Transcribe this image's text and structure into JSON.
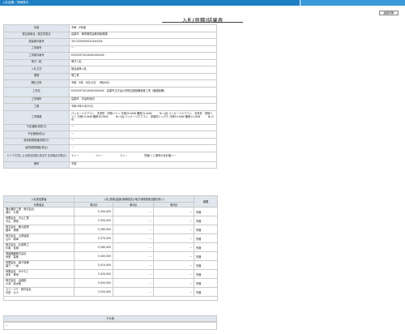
{
  "header": {
    "title": "入札結果／詳細表示"
  },
  "toolbar": {
    "print_label": "画面印刷"
  },
  "page_title": "入札(見積)結果表",
  "info_rows": [
    {
      "label": "年度",
      "value": "令和　6年度"
    },
    {
      "label": "発注部局名／発注所属名",
      "value": "高梁市　教育委員会教育総務課"
    },
    {
      "label": "調達案件番号",
      "value": "3311335500020240004"
    },
    {
      "label": "工事番号",
      "value": "－"
    },
    {
      "label": "工事案件番号",
      "value": "K3320972024050000004"
    },
    {
      "label": "電子／紙",
      "value": "電子入札"
    },
    {
      "label": "入札方式",
      "value": "指名競争入札"
    },
    {
      "label": "業種",
      "value": "電工事"
    },
    {
      "label": "開札日時",
      "value": "令和　6年　6月12日　 9時00分"
    },
    {
      "label": "工事名",
      "value": "K3320972024050000004　高梁市立宇治小学校空調設備設置工事（機械設備）"
    },
    {
      "label": "工事場所",
      "value": "高梁市　宇治町地内"
    },
    {
      "label": "工期",
      "value": "令和 6年10月31日"
    },
    {
      "label": "工事概要",
      "value": "パッケージエアコン　天吊形　同時ツイン 冷房20.0kW 暖房22.4kW　　　N=1台 パッケージエアコン　天吊形　同時ツイン 冷房14.0kW 暖房16.0kW　　　N=1台 パッケージエアコン　床置形シングル 冷房10.0kW 暖房11.2kW　　　N=2台"
    },
    {
      "label": "予定価格(税抜き)",
      "value": "－"
    },
    {
      "label": "予定価格(税込)",
      "value": "－"
    },
    {
      "label": "最低制限価格(税抜き)",
      "value": "－"
    },
    {
      "label": "最低制限価格(税込)",
      "value": "－"
    },
    {
      "label": "ＸＹＺ方式による総合評価\n(該当する評価点の表示)",
      "value": ""
    },
    {
      "label": "備考",
      "value": "不調"
    }
  ],
  "xyz": {
    "x": "Ｘ＝－",
    "y": "Ｙ＝－",
    "z": "Ｚ＝－",
    "total": "失格(くじ番号の合計値＝－"
  },
  "bid_table": {
    "participant_header": "入札参加業者",
    "amount_header": "入札(見積)金額(消費税及び地方消費税相当額を除く)",
    "notes_header": "摘要",
    "rep_label": "代表者名",
    "round1": "第1回",
    "round2": "第2回",
    "round3": "第3回",
    "rows": [
      {
        "company": "藩の離防工業　株式会社",
        "rep": "瀧口　久雄",
        "r1": "5,300,000",
        "r2": "－",
        "r3": "－",
        "note": "失格"
      },
      {
        "company": "有限会社　平山工業",
        "rep": "平山　陽男",
        "r1": "5,350,000",
        "r2": "－",
        "r3": "－",
        "note": "失格"
      },
      {
        "company": "株式会社　藤元産業",
        "rep": "藤本　博美",
        "r1": "5,360,000",
        "r2": "－",
        "r3": "－",
        "note": "失格"
      },
      {
        "company": "株式会社　山栄建設",
        "rep": "山口　耕幸",
        "r1": "5,370,000",
        "r2": "－",
        "r3": "－",
        "note": "失格"
      },
      {
        "company": "株式会社　杉原電工",
        "rep": "杉原　信雄",
        "r1": "5,380,000",
        "r2": "－",
        "r3": "－",
        "note": "失格"
      },
      {
        "company": "電福機器株式会社",
        "rep": "伊田　智美",
        "r1": "5,400,000",
        "r2": "－",
        "r3": "－",
        "note": "失格"
      },
      {
        "company": "有限会社　森下設備",
        "rep": "森下　一幸",
        "r1": "5,410,000",
        "r2": "－",
        "r3": "－",
        "note": "失格"
      },
      {
        "company": "有限会社　みやもと",
        "rep": "宮本　伸司",
        "r1": "5,420,000",
        "r2": "－",
        "r3": "－",
        "note": "失格"
      },
      {
        "company": "株式会社　高蔵産",
        "rep": "小池　慶太郎",
        "r1": "5,450,000",
        "r2": "－",
        "r3": "－",
        "note": "失格"
      },
      {
        "company": "スリーコウ　株式会社",
        "rep": "中田　公人",
        "r1": "5,500,000",
        "r2": "－",
        "r3": "－",
        "note": "失格"
      }
    ]
  },
  "other": {
    "header": "その他",
    "value": "－"
  }
}
